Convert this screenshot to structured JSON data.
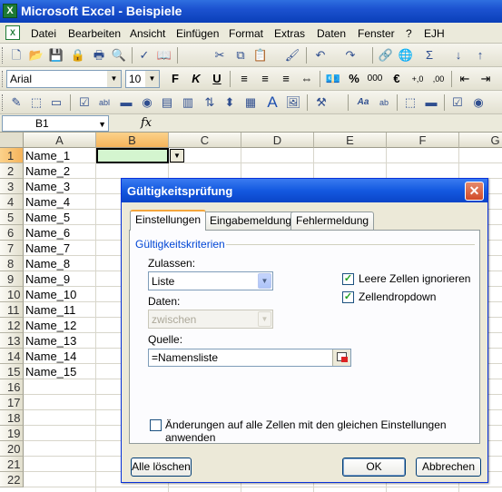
{
  "window": {
    "title": "Microsoft Excel - Beispiele"
  },
  "menu": {
    "items": [
      "Datei",
      "Bearbeiten",
      "Ansicht",
      "Einfügen",
      "Format",
      "Extras",
      "Daten",
      "Fenster",
      "?",
      "EJH"
    ]
  },
  "formatting": {
    "font": "Arial",
    "size": "10",
    "percent": "%",
    "thousands": "000",
    "euro": "€"
  },
  "namebar": {
    "cell_ref": "B1",
    "fx": "fx"
  },
  "sheet": {
    "columns": [
      "A",
      "B",
      "C",
      "D",
      "E",
      "F",
      "G"
    ],
    "rows": [
      "1",
      "2",
      "3",
      "4",
      "5",
      "6",
      "7",
      "8",
      "9",
      "10",
      "11",
      "12",
      "13",
      "14",
      "15",
      "16",
      "17",
      "18",
      "19",
      "20",
      "21",
      "22"
    ],
    "column_a": [
      "Name_1",
      "Name_2",
      "Name_3",
      "Name_4",
      "Name_5",
      "Name_6",
      "Name_7",
      "Name_8",
      "Name_9",
      "Name_10",
      "Name_11",
      "Name_12",
      "Name_13",
      "Name_14",
      "Name_15"
    ]
  },
  "dialog": {
    "title": "Gültigkeitsprüfung",
    "tabs": [
      "Einstellungen",
      "Eingabemeldung",
      "Fehlermeldung"
    ],
    "group_label": "Gültigkeitskriterien",
    "zulassen_label": "Zulassen:",
    "zulassen_value": "Liste",
    "daten_label": "Daten:",
    "daten_value": "zwischen",
    "quelle_label": "Quelle:",
    "quelle_value": "=Namensliste",
    "check_leere": "Leere Zellen ignorieren",
    "check_dropdown": "Zellendropdown",
    "check_apply_all": "Änderungen auf alle Zellen mit den gleichen Einstellungen anwenden",
    "btn_clear": "Alle löschen",
    "btn_ok": "OK",
    "btn_cancel": "Abbrechen",
    "close_glyph": "✕"
  }
}
